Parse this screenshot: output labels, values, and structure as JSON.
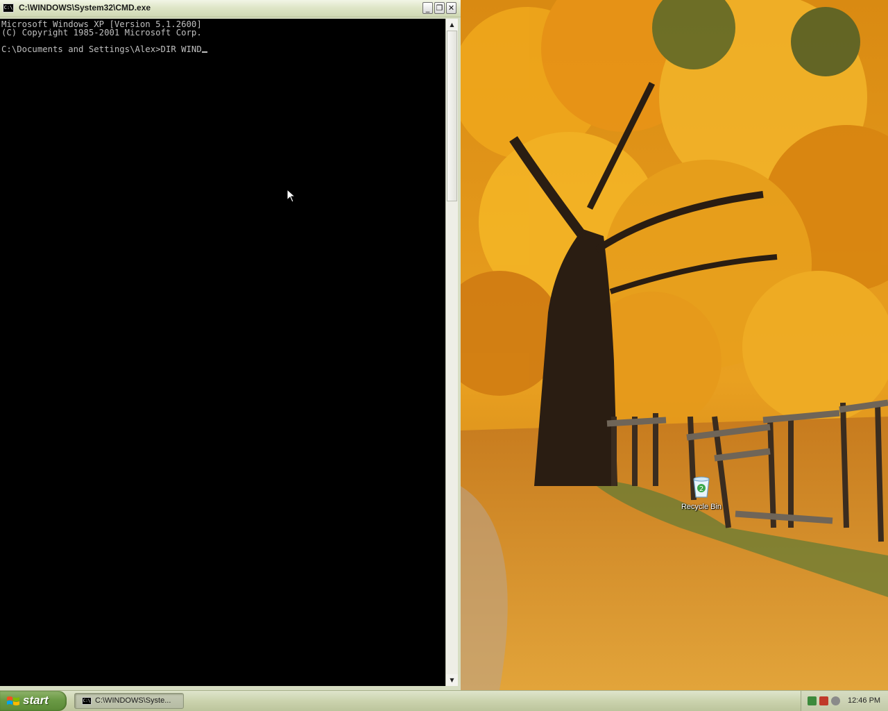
{
  "window": {
    "title": "C:\\WINDOWS\\System32\\CMD.exe",
    "icon": "cmd-icon",
    "controls": {
      "minimize": "_",
      "restore": "❐",
      "close": "✕"
    }
  },
  "console": {
    "line1": "Microsoft Windows XP [Version 5.1.2600]",
    "line2": "(C) Copyright 1985-2001 Microsoft Corp.",
    "line3": "",
    "prompt": "C:\\Documents and Settings\\Alex>",
    "command": "DIR WIND",
    "text_color": "#c0c0c0",
    "background": "#000000"
  },
  "desktop": {
    "recycle_bin_label": "Recycle Bin"
  },
  "taskbar": {
    "start_label": "start",
    "task_button_label": "C:\\WINDOWS\\Syste...",
    "clock": "12:46 PM"
  }
}
